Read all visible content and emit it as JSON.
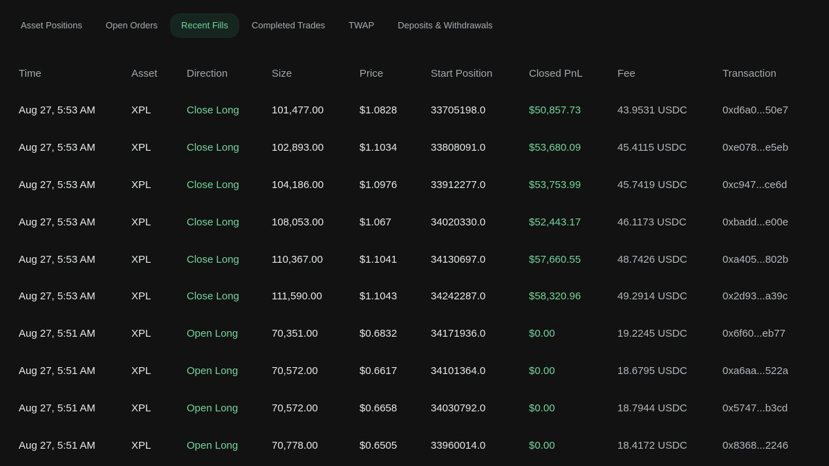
{
  "tabs": [
    {
      "label": "Asset Positions",
      "active": false
    },
    {
      "label": "Open Orders",
      "active": false
    },
    {
      "label": "Recent Fills",
      "active": true
    },
    {
      "label": "Completed Trades",
      "active": false
    },
    {
      "label": "TWAP",
      "active": false
    },
    {
      "label": "Deposits & Withdrawals",
      "active": false
    }
  ],
  "colors": {
    "background": "#121212",
    "positive": "#6fd79b",
    "active_tab_bg": "#16251f"
  },
  "table": {
    "columns": [
      "Time",
      "Asset",
      "Direction",
      "Size",
      "Price",
      "Start Position",
      "Closed PnL",
      "Fee",
      "Transaction"
    ],
    "rows": [
      [
        "Aug 27, 5:53 AM",
        "XPL",
        "Close Long",
        "101,477.00",
        "$1.0828",
        "33705198.0",
        "$50,857.73",
        "43.9531 USDC",
        "0xd6a0...50e7"
      ],
      [
        "Aug 27, 5:53 AM",
        "XPL",
        "Close Long",
        "102,893.00",
        "$1.1034",
        "33808091.0",
        "$53,680.09",
        "45.4115 USDC",
        "0xe078...e5eb"
      ],
      [
        "Aug 27, 5:53 AM",
        "XPL",
        "Close Long",
        "104,186.00",
        "$1.0976",
        "33912277.0",
        "$53,753.99",
        "45.7419 USDC",
        "0xc947...ce6d"
      ],
      [
        "Aug 27, 5:53 AM",
        "XPL",
        "Close Long",
        "108,053.00",
        "$1.067",
        "34020330.0",
        "$52,443.17",
        "46.1173 USDC",
        "0xbadd...e00e"
      ],
      [
        "Aug 27, 5:53 AM",
        "XPL",
        "Close Long",
        "110,367.00",
        "$1.1041",
        "34130697.0",
        "$57,660.55",
        "48.7426 USDC",
        "0xa405...802b"
      ],
      [
        "Aug 27, 5:53 AM",
        "XPL",
        "Close Long",
        "111,590.00",
        "$1.1043",
        "34242287.0",
        "$58,320.96",
        "49.2914 USDC",
        "0x2d93...a39c"
      ],
      [
        "Aug 27, 5:51 AM",
        "XPL",
        "Open Long",
        "70,351.00",
        "$0.6832",
        "34171936.0",
        "$0.00",
        "19.2245 USDC",
        "0x6f60...eb77"
      ],
      [
        "Aug 27, 5:51 AM",
        "XPL",
        "Open Long",
        "70,572.00",
        "$0.6617",
        "34101364.0",
        "$0.00",
        "18.6795 USDC",
        "0xa6aa...522a"
      ],
      [
        "Aug 27, 5:51 AM",
        "XPL",
        "Open Long",
        "70,572.00",
        "$0.6658",
        "34030792.0",
        "$0.00",
        "18.7944 USDC",
        "0x5747...b3cd"
      ],
      [
        "Aug 27, 5:51 AM",
        "XPL",
        "Open Long",
        "70,778.00",
        "$0.6505",
        "33960014.0",
        "$0.00",
        "18.4172 USDC",
        "0x8368...2246"
      ]
    ]
  }
}
